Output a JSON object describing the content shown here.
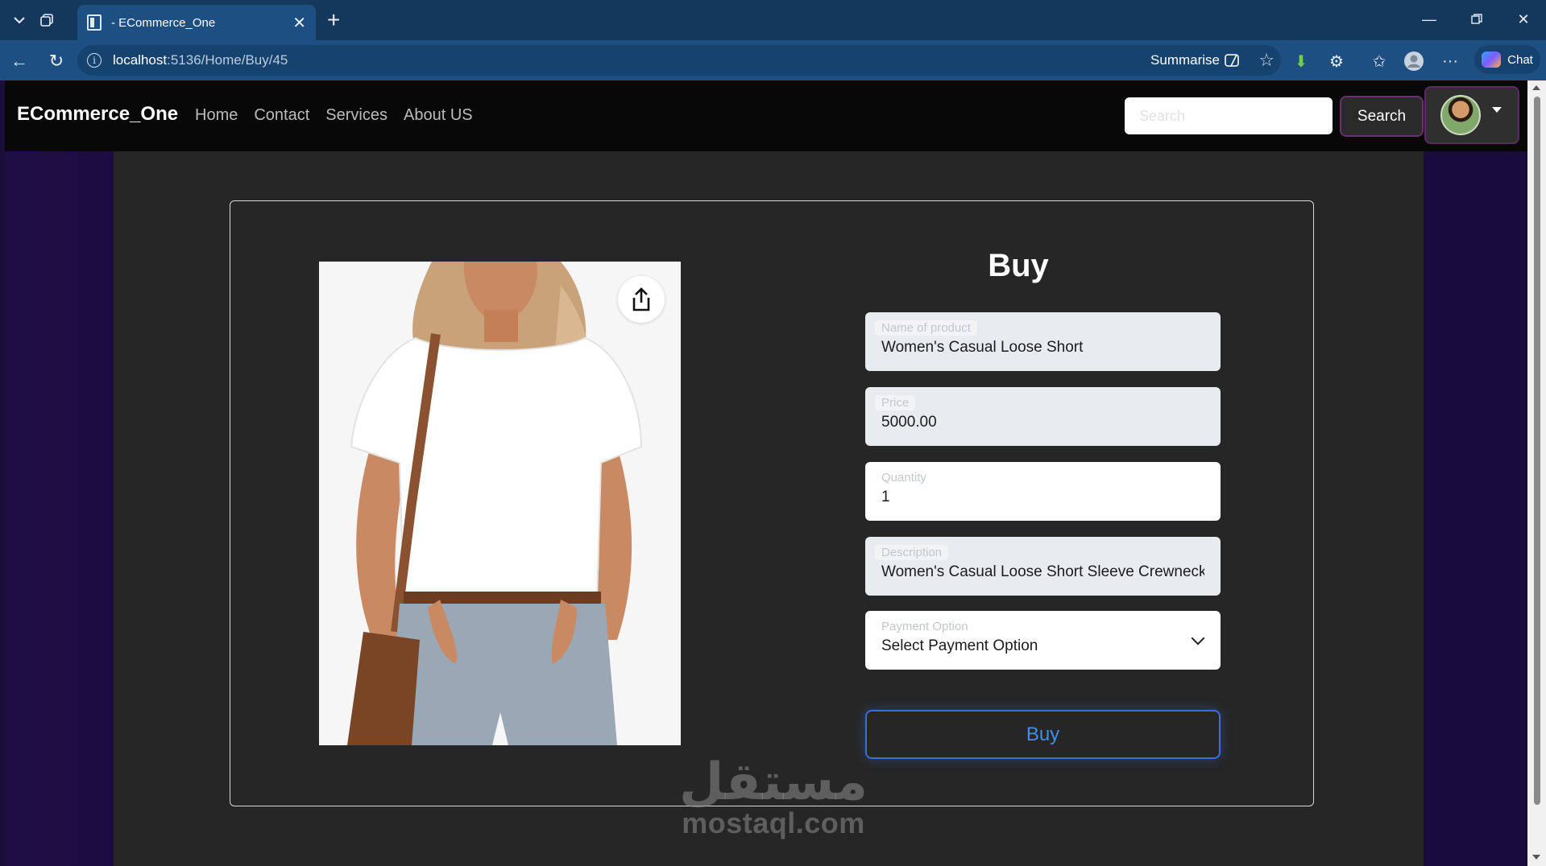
{
  "browser": {
    "tab_title": "- ECommerce_One",
    "url_host": "localhost",
    "url_path": ":5136/Home/Buy/45",
    "summarise_label": "Summarise",
    "chat_label": "Chat"
  },
  "navbar": {
    "brand": "ECommerce_One",
    "links": [
      "Home",
      "Contact",
      "Services",
      "About US"
    ],
    "search_placeholder": "Search",
    "search_button": "Search"
  },
  "form": {
    "title": "Buy",
    "fields": [
      {
        "label": "Name of product",
        "value": "Women's Casual Loose Short"
      },
      {
        "label": "Price",
        "value": "5000.00"
      },
      {
        "label": "Quantity",
        "value": "1"
      },
      {
        "label": "Description",
        "value": "Women's Casual Loose Short Sleeve Crewneck"
      },
      {
        "label": "Payment Option",
        "value": "Select Payment Option"
      }
    ],
    "buy_button": "Buy"
  },
  "watermark": {
    "arabic": "مستقل",
    "latin": "mostaql.com"
  },
  "colors": {
    "navbar_bg": "#080808",
    "panel_bg": "#262626",
    "page_bg": "#1e0c44",
    "accent_blue": "#3d6ce0",
    "search_border": "#6a2f6e"
  },
  "icons": {
    "share": "share-icon",
    "chevron": "chevron-down-icon",
    "info": "info-icon"
  }
}
